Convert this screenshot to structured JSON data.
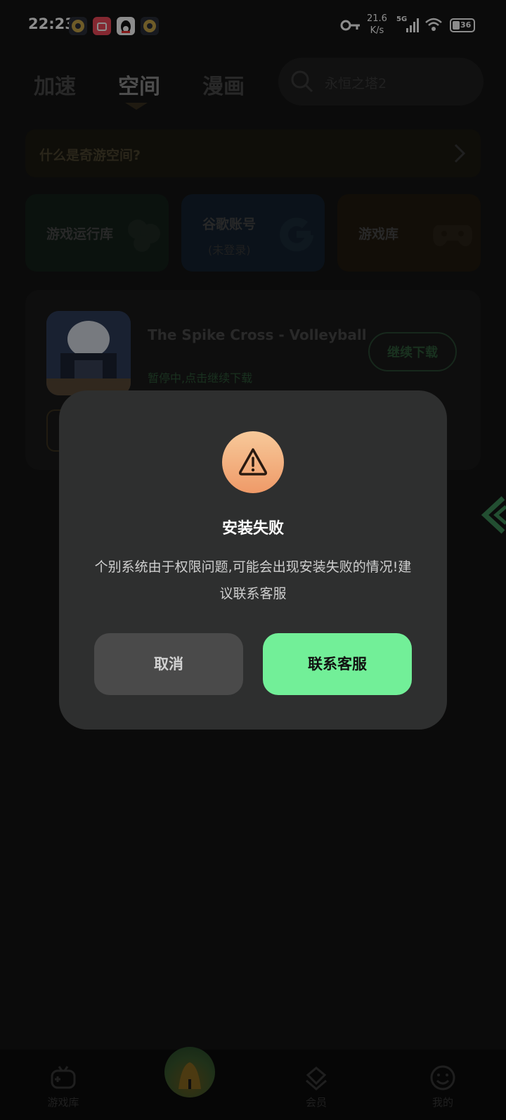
{
  "status_bar": {
    "time": "22:23",
    "net_speed_value": "21.6",
    "net_speed_unit": "K/s",
    "network": "5G",
    "battery": "36"
  },
  "top_nav": {
    "tabs": [
      {
        "label": "加速"
      },
      {
        "label": "空间"
      },
      {
        "label": "漫画"
      }
    ],
    "search_placeholder": "永恒之塔2"
  },
  "banner": {
    "text": "什么是奇游空间?"
  },
  "tiles": [
    {
      "label": "游戏运行库",
      "sub": ""
    },
    {
      "label": "谷歌账号",
      "sub": "(未登录)"
    },
    {
      "label": "游戏库",
      "sub": ""
    }
  ],
  "game_card": {
    "title": "The Spike Cross - Volleyball",
    "status": "暂停中,点击继续下载",
    "action": "继续下载"
  },
  "dialog": {
    "title": "安装失败",
    "message": "个别系统由于权限问题,可能会出现安装失败的情况!建议联系客服",
    "cancel": "取消",
    "confirm": "联系客服"
  },
  "bottom_nav": {
    "items": [
      {
        "label": "游戏库"
      },
      {
        "label": "会员"
      },
      {
        "label": "我的"
      }
    ]
  },
  "colors": {
    "accent_green": "#72ef98",
    "modal_bg": "#2e2f2f",
    "warning_orange": "#ef9a68"
  }
}
